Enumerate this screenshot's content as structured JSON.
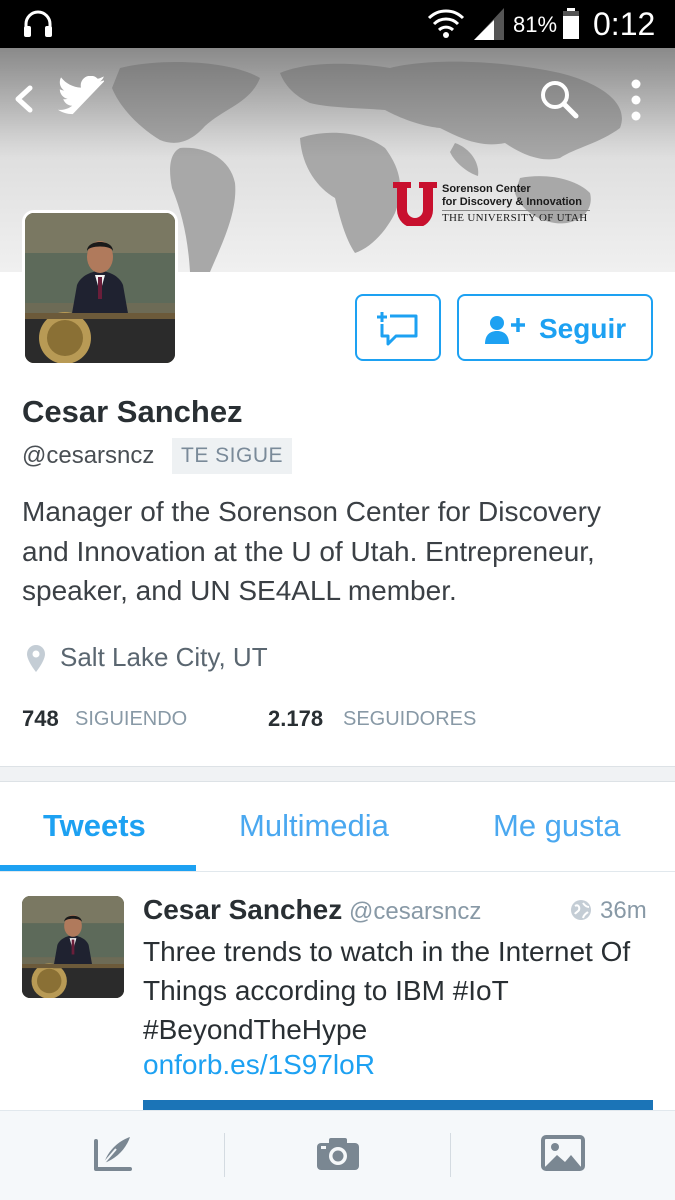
{
  "status_bar": {
    "battery_percent": "81%",
    "time": "0:12",
    "icons": [
      "headset-icon",
      "wifi-icon",
      "signal-icon",
      "battery-icon"
    ]
  },
  "header": {
    "icons": [
      "back-arrow-icon",
      "twitter-bird-icon",
      "search-icon",
      "more-vert-icon"
    ],
    "logo": {
      "line1": "Sorenson Center",
      "line2": "for Discovery & Innovation",
      "line3": "THE UNIVERSITY OF UTAH",
      "mark_color": "#c8102e"
    }
  },
  "profile": {
    "name": "Cesar Sanchez",
    "handle": "@cesarsncz",
    "follows_you_badge": "TE SIGUE",
    "bio": "Manager of the Sorenson Center for Discovery and Innovation at the U of Utah. Entrepreneur, speaker, and UN SE4ALL member.",
    "location": "Salt Lake City, UT",
    "following_count": "748",
    "following_label": "SIGUIENDO",
    "followers_count": "2.178",
    "followers_label": "SEGUIDORES",
    "follow_button_label": "Seguir"
  },
  "tabs": [
    {
      "label": "Tweets",
      "active": true
    },
    {
      "label": "Multimedia",
      "active": false
    },
    {
      "label": "Me gusta",
      "active": false
    }
  ],
  "tweet": {
    "name": "Cesar Sanchez",
    "handle": "@cesarsncz",
    "time": "36m",
    "text": "Three trends to watch in the Internet Of Things according to IBM  #IoT #BeyondTheHype",
    "link": "onforb.es/1S97loR"
  },
  "bottom_bar": {
    "icons": [
      "compose-tweet-icon",
      "camera-icon",
      "gallery-icon"
    ]
  },
  "colors": {
    "accent": "#1da1f2",
    "text": "#292f33",
    "muted": "#8899a6",
    "status_bar": "#000000"
  }
}
